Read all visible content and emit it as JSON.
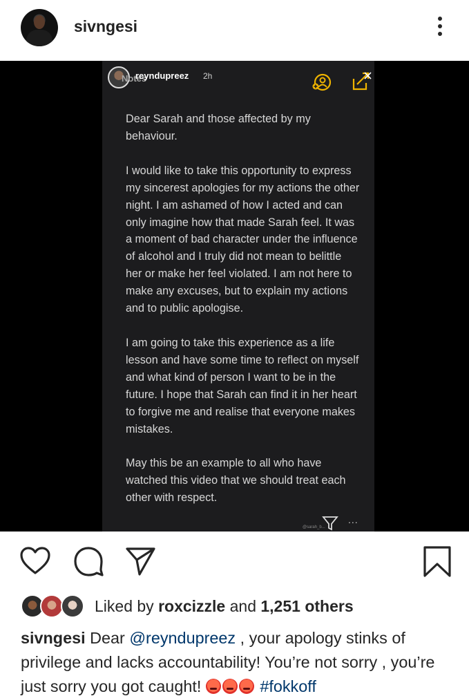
{
  "header": {
    "username": "sivngesi",
    "more_icon": "more-vertical-icon"
  },
  "story": {
    "notes_tag": "Notes",
    "username": "reyndupreez",
    "time": "2h",
    "paragraphs": [
      "Dear Sarah and those affected by my behaviour.",
      "I would like to take this opportunity to express my sincerest apologies for my actions the other night. I am ashamed of how I acted and can only imagine how that made Sarah feel. It was a moment of bad character under the influence of alcohol and I truly did not mean to belittle her or make her feel violated. I am not here to make any excuses, but to explain my actions and to public apologise.",
      "I am going to take this experience as a life lesson and have some time to reflect on myself and what kind of person I want to be in the future. I hope that Sarah can find it in her heart to forgive me and realise that everyone makes mistakes.",
      "May this be an example to all who have watched this video that we should treat each other with respect."
    ],
    "dots": "...",
    "handle": "@sarah_b..."
  },
  "actions": {
    "like_icon": "heart-icon",
    "comment_icon": "comment-icon",
    "share_icon": "send-icon",
    "save_icon": "bookmark-icon"
  },
  "likes": {
    "prefix": "Liked by ",
    "user": "roxcizzle",
    "middle": " and ",
    "count": "1,251 others"
  },
  "caption": {
    "user": "sivngesi",
    "text_before": " Dear ",
    "mention": "@reyndupreez",
    "text_after": " , your apology stinks of privilege and lacks accountability! You’re not sorry , you’re just sorry you got caught! ",
    "emoji": "angry-face-emoji",
    "hashtag": "#fokkoff"
  },
  "colors": {
    "link": "#00376b",
    "story_bg": "#1c1c1e",
    "story_icon_accent": "#f0b400"
  }
}
